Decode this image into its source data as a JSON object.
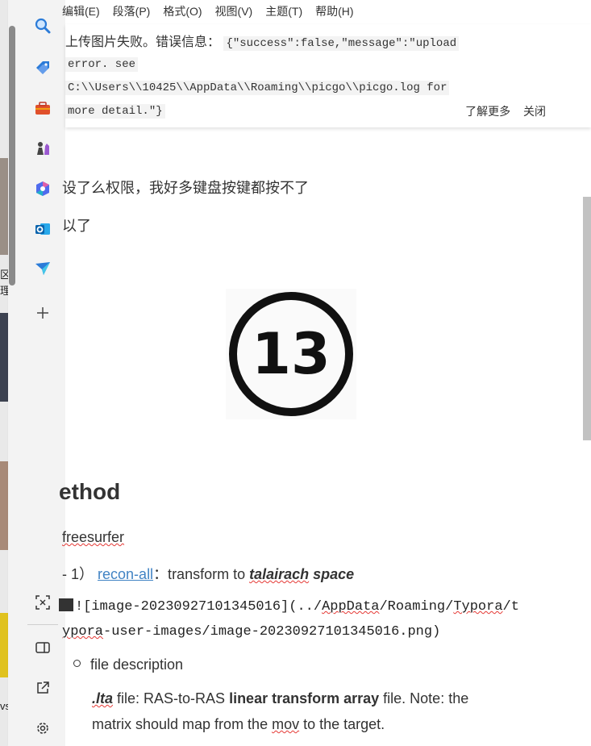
{
  "menu": [
    "编辑(E)",
    "段落(P)",
    "格式(O)",
    "视图(V)",
    "主题(T)",
    "帮助(H)"
  ],
  "notice": {
    "message": "上传图片失败。错误信息：",
    "code_lines": [
      "{\"success\":false,\"message\":\"upload",
      "error. see",
      "C:\\\\Users\\\\10425\\\\AppData\\\\Roaming\\\\picgo\\\\picgo.log for",
      "more detail.\"}"
    ],
    "learn_more": "了解更多",
    "close": "关闭"
  },
  "content": {
    "line1": "设了么权限，我好多键盘按键都按不了",
    "line2": "以了",
    "image_text": "13",
    "heading": "ethod",
    "freesurfer": "freesurfer",
    "step_prefix": "- 1）",
    "recon_link": "recon-all",
    "transform_text": "：transform to ",
    "talairach": "talairach",
    "space": " space",
    "img_md_line1_prefix": "![image-20230927101345016](../",
    "img_md_appdata": "AppData",
    "img_md_mid": "/Roaming/",
    "img_md_typora": "Typora",
    "img_md_end": "/t",
    "img_md_line2_ypora": "ypora",
    "img_md_line2_rest": "-user-images/image-20230927101345016.png)",
    "file_desc": "file description",
    "lta": ".lta",
    "lta_text1": " file: RAS-to-RAS ",
    "lta_bold": "linear transform array",
    "lta_text2": " file.  Note: the",
    "lta_line2_a": "matrix should map from the ",
    "lta_line2_mov": "mov",
    "lta_line2_b": " to the target."
  },
  "behind": {
    "text1": "区",
    "text2": "理",
    "text3": "vs"
  },
  "colors": {
    "link": "#4183c4",
    "sidebar_bg": "#f3f3f3",
    "code_bg": "#f3f3f3"
  },
  "icons": [
    "search-icon",
    "tag-icon",
    "toolbox-icon",
    "chess-icon",
    "copilot-icon",
    "outlook-icon",
    "send-icon",
    "add-icon",
    "screenshot-icon",
    "split-view-icon",
    "external-link-icon",
    "settings-icon"
  ]
}
